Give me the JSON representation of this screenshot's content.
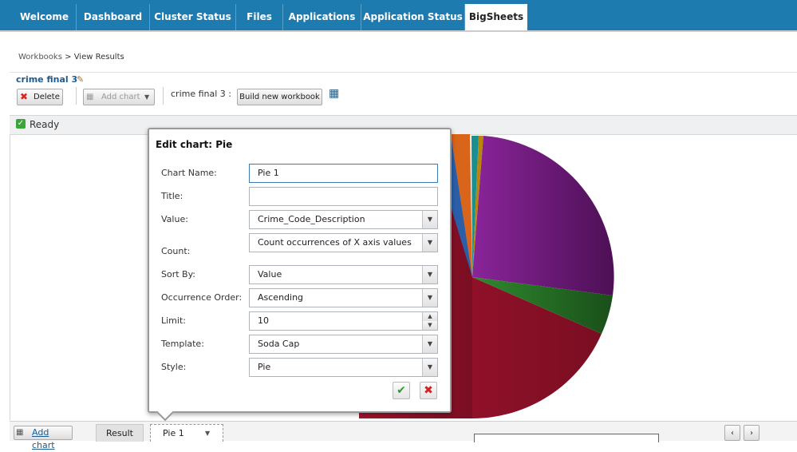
{
  "nav": {
    "tabs": [
      {
        "label": "Welcome"
      },
      {
        "label": "Dashboard"
      },
      {
        "label": "Cluster Status"
      },
      {
        "label": "Files"
      },
      {
        "label": "Applications"
      },
      {
        "label": "Application Status"
      },
      {
        "label": "BigSheets"
      }
    ],
    "active_tab": "BigSheets"
  },
  "breadcrumb": {
    "parent": "Workbooks",
    "separator": ">",
    "current": "View Results"
  },
  "workbook": {
    "title": "crime final 3"
  },
  "toolbar": {
    "delete_label": "Delete",
    "add_chart_label": "Add chart",
    "sheet_label": "crime final 3 :",
    "build_label": "Build new workbook"
  },
  "status": {
    "text": "Ready"
  },
  "dialog": {
    "title": "Edit chart: Pie",
    "fields": {
      "chart_name": {
        "label": "Chart Name:",
        "value": "Pie 1"
      },
      "title": {
        "label": "Title:",
        "value": ""
      },
      "value": {
        "label": "Value:",
        "value": "Crime_Code_Description"
      },
      "count": {
        "label": "Count:",
        "value": "Count occurrences of X axis values"
      },
      "sort_by": {
        "label": "Sort By:",
        "value": "Value"
      },
      "occurrence_order": {
        "label": "Occurrence Order:",
        "value": "Ascending"
      },
      "limit": {
        "label": "Limit:",
        "value": "10"
      },
      "template": {
        "label": "Template:",
        "value": "Soda Cap"
      },
      "style": {
        "label": "Style:",
        "value": "Pie"
      }
    }
  },
  "pie_colors": {
    "crimson": "#8e1128",
    "purple": "#6a1a76",
    "green": "#1f6a1f",
    "orange": "#d9651a",
    "teal": "#1a8f8f",
    "gold": "#b8860b",
    "blue": "#2a5fa8"
  },
  "bottom": {
    "add_chart_label": "Add chart",
    "result_tab": "Result",
    "pie_tab": "Pie 1"
  },
  "icons": [
    "pencil-icon",
    "delete-icon",
    "add-chart-icon",
    "dropdown-icon",
    "grid-icon",
    "check-icon",
    "ok-icon",
    "cancel-icon",
    "arrow-left-icon",
    "arrow-right-icon"
  ]
}
